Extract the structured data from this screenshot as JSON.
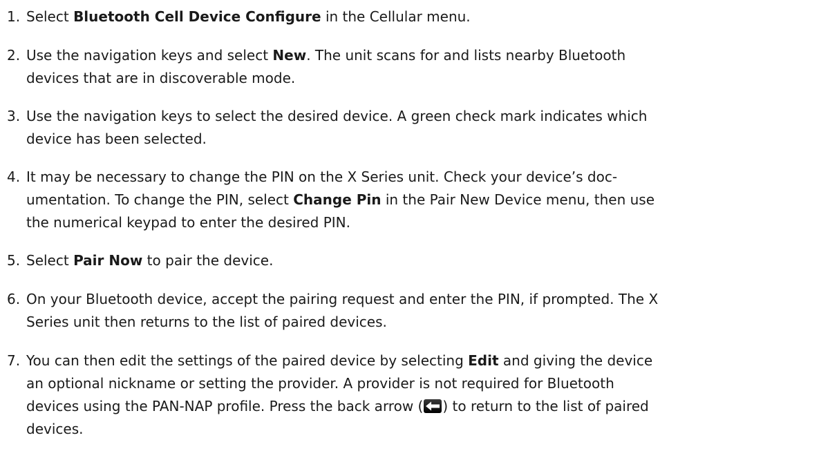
{
  "steps": [
    {
      "number": "1.",
      "lines": [
        [
          {
            "t": "Select "
          },
          {
            "t": "Bluetooth Cell Device Configure",
            "b": true
          },
          {
            "t": " in the Cellular menu."
          }
        ]
      ]
    },
    {
      "number": "2.",
      "lines": [
        [
          {
            "t": "Use the navigation keys and select "
          },
          {
            "t": "New",
            "b": true
          },
          {
            "t": ". The unit scans for and lists nearby Bluetooth"
          }
        ],
        [
          {
            "t": "devices that are in discoverable mode."
          }
        ]
      ]
    },
    {
      "number": "3.",
      "lines": [
        [
          {
            "t": "Use the navigation keys to select the desired device. A green check mark indicates which"
          }
        ],
        [
          {
            "t": "device has been selected."
          }
        ]
      ]
    },
    {
      "number": "4.",
      "lines": [
        [
          {
            "t": "It may be necessary to change the PIN on the X Series unit. Check your device’s doc-"
          }
        ],
        [
          {
            "t": "umentation. To change the PIN, select "
          },
          {
            "t": "Change Pin",
            "b": true
          },
          {
            "t": " in the Pair New Device menu, then use"
          }
        ],
        [
          {
            "t": "the numerical keypad to enter the desired PIN."
          }
        ]
      ]
    },
    {
      "number": "5.",
      "lines": [
        [
          {
            "t": "Select "
          },
          {
            "t": "Pair Now",
            "b": true
          },
          {
            "t": " to pair the device."
          }
        ]
      ]
    },
    {
      "number": "6.",
      "lines": [
        [
          {
            "t": "On your Bluetooth device, accept the pairing request and enter the PIN, if prompted. The X"
          }
        ],
        [
          {
            "t": "Series unit then returns to the list of paired devices."
          }
        ]
      ]
    },
    {
      "number": "7.",
      "lines": [
        [
          {
            "t": "You can then edit the settings of the paired device by selecting "
          },
          {
            "t": "Edit",
            "b": true
          },
          {
            "t": " and giving the device"
          }
        ],
        [
          {
            "t": "an optional nickname or setting the provider. A provider is not required for Bluetooth"
          }
        ],
        [
          {
            "t": "devices using the PAN-NAP profile. Press the back arrow ("
          },
          {
            "icon": "back-arrow-icon"
          },
          {
            "t": ") to return to the list of paired"
          }
        ],
        [
          {
            "t": "devices."
          }
        ]
      ]
    }
  ]
}
